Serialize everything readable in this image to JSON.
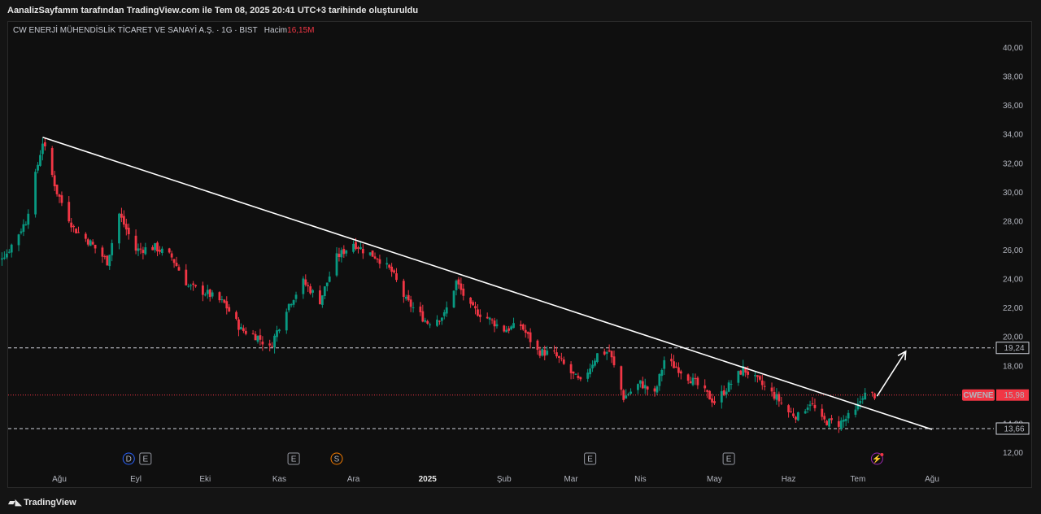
{
  "snapshot_caption": "AanalizSayfamm tarafından TradingView.com ile Tem 08, 2025 20:41 UTC+3 tarihinde oluşturuldu",
  "header": {
    "symbol_name": "CW ENERJİ MÜHENDİSLİK TİCARET VE SANAYİ A.Ş.",
    "timeframe": "1G",
    "exchange": "BIST",
    "volume_label": "Hacim",
    "volume_value": "16,15M"
  },
  "brand": "TradingView",
  "colors": {
    "up": "#089981",
    "down": "#f23645",
    "trendline": "#ffffff",
    "last_price_bg": "#f23645",
    "background": "#0f0f0f"
  },
  "chart_data": {
    "type": "candlestick",
    "symbol": "CWENE",
    "last_price": "15,98",
    "y_axis": {
      "ylim": [
        11.0,
        41.0
      ],
      "ticks": [
        "12,00",
        "14,00",
        "18,00",
        "20,00",
        "22,00",
        "24,00",
        "26,00",
        "28,00",
        "30,00",
        "32,00",
        "34,00",
        "36,00",
        "38,00",
        "40,00"
      ]
    },
    "x_axis": {
      "ticks": [
        {
          "label": "Ağu",
          "date": "2024-08-01"
        },
        {
          "label": "Eyl",
          "date": "2024-09-02"
        },
        {
          "label": "Eki",
          "date": "2024-10-01"
        },
        {
          "label": "Kas",
          "date": "2024-11-01"
        },
        {
          "label": "Ara",
          "date": "2024-12-02"
        },
        {
          "label": "2025",
          "date": "2025-01-02",
          "bold": true
        },
        {
          "label": "Şub",
          "date": "2025-02-03"
        },
        {
          "label": "Mar",
          "date": "2025-03-03"
        },
        {
          "label": "Nis",
          "date": "2025-04-01"
        },
        {
          "label": "May",
          "date": "2025-05-02"
        },
        {
          "label": "Haz",
          "date": "2025-06-02"
        },
        {
          "label": "Tem",
          "date": "2025-07-01"
        },
        {
          "label": "Ağu",
          "date": "2025-08-01"
        }
      ]
    },
    "horizontal_levels": [
      {
        "value": 19.24,
        "label": "19,24",
        "style": "dashed"
      },
      {
        "value": 13.66,
        "label": "13,66",
        "style": "dashed"
      }
    ],
    "trendline": {
      "from": {
        "date": "2024-07-25",
        "value": 33.8
      },
      "to": {
        "date": "2025-08-01",
        "value": 13.6
      }
    },
    "arrow": {
      "from": {
        "date": "2025-07-09",
        "value": 15.9
      },
      "to": {
        "date": "2025-07-21",
        "value": 19.0
      }
    },
    "event_markers": [
      {
        "date": "2024-08-30",
        "icon": "D"
      },
      {
        "date": "2024-09-06",
        "icon": "E"
      },
      {
        "date": "2024-11-07",
        "icon": "E"
      },
      {
        "date": "2024-11-25",
        "icon": "S"
      },
      {
        "date": "2025-03-11",
        "icon": "E"
      },
      {
        "date": "2025-05-08",
        "icon": "E"
      },
      {
        "date": "2025-07-09",
        "icon": "bolt"
      }
    ],
    "close_path": [
      [
        "2024-07-01",
        25.0
      ],
      [
        "2024-07-10",
        25.8
      ],
      [
        "2024-07-18",
        28.0
      ],
      [
        "2024-07-25",
        33.5
      ],
      [
        "2024-07-31",
        30.0
      ],
      [
        "2024-08-07",
        27.5
      ],
      [
        "2024-08-14",
        26.5
      ],
      [
        "2024-08-21",
        25.2
      ],
      [
        "2024-08-26",
        28.5
      ],
      [
        "2024-09-02",
        26.0
      ],
      [
        "2024-09-10",
        26.2
      ],
      [
        "2024-09-17",
        25.5
      ],
      [
        "2024-09-24",
        23.5
      ],
      [
        "2024-10-02",
        23.0
      ],
      [
        "2024-10-09",
        22.3
      ],
      [
        "2024-10-16",
        20.5
      ],
      [
        "2024-10-23",
        20.0
      ],
      [
        "2024-10-28",
        19.2
      ],
      [
        "2024-11-04",
        22.0
      ],
      [
        "2024-11-11",
        23.8
      ],
      [
        "2024-11-18",
        22.5
      ],
      [
        "2024-11-25",
        25.5
      ],
      [
        "2024-12-02",
        26.5
      ],
      [
        "2024-12-06",
        26.0
      ],
      [
        "2024-12-12",
        25.5
      ],
      [
        "2024-12-18",
        24.5
      ],
      [
        "2024-12-24",
        22.5
      ],
      [
        "2025-01-02",
        21.0
      ],
      [
        "2025-01-09",
        21.5
      ],
      [
        "2025-01-14",
        23.8
      ],
      [
        "2025-01-20",
        22.0
      ],
      [
        "2025-01-27",
        21.3
      ],
      [
        "2025-02-03",
        20.5
      ],
      [
        "2025-02-10",
        20.8
      ],
      [
        "2025-02-17",
        19.0
      ],
      [
        "2025-02-24",
        18.8
      ],
      [
        "2025-03-03",
        17.5
      ],
      [
        "2025-03-07",
        16.8
      ],
      [
        "2025-03-14",
        18.8
      ],
      [
        "2025-03-19",
        19.0
      ],
      [
        "2025-03-25",
        15.8
      ],
      [
        "2025-04-01",
        16.8
      ],
      [
        "2025-04-07",
        16.0
      ],
      [
        "2025-04-11",
        18.4
      ],
      [
        "2025-04-17",
        17.8
      ],
      [
        "2025-04-24",
        16.8
      ],
      [
        "2025-05-02",
        15.5
      ],
      [
        "2025-05-09",
        16.8
      ],
      [
        "2025-05-14",
        17.8
      ],
      [
        "2025-05-21",
        16.8
      ],
      [
        "2025-05-28",
        15.8
      ],
      [
        "2025-06-02",
        14.8
      ],
      [
        "2025-06-06",
        14.5
      ],
      [
        "2025-06-11",
        15.5
      ],
      [
        "2025-06-16",
        14.2
      ],
      [
        "2025-06-23",
        14.0
      ],
      [
        "2025-06-30",
        14.8
      ],
      [
        "2025-07-03",
        16.0
      ],
      [
        "2025-07-08",
        15.98
      ]
    ]
  }
}
